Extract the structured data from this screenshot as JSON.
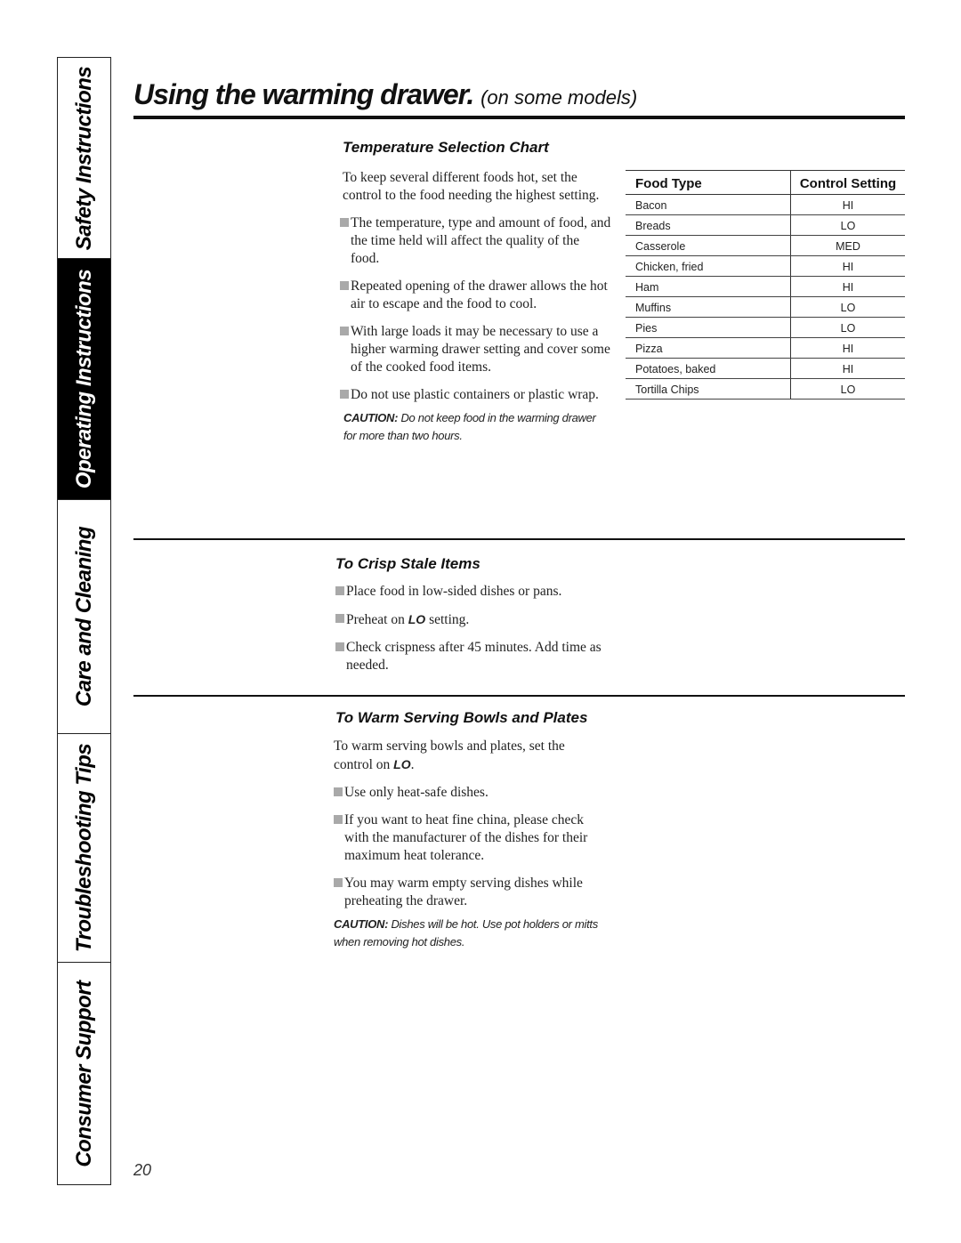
{
  "sidebar": {
    "tabs": [
      {
        "label": "Safety Instructions",
        "active": false
      },
      {
        "label": "Operating Instructions",
        "active": true
      },
      {
        "label": "Care and Cleaning",
        "active": false
      },
      {
        "label": "Troubleshooting Tips",
        "active": false
      },
      {
        "label": "Consumer Support",
        "active": false
      }
    ]
  },
  "header": {
    "title": "Using the warming drawer.",
    "subtitle": "(on some models)"
  },
  "temperature_chart": {
    "heading": "Temperature Selection Chart",
    "intro": "To keep several different foods hot, set the control to the food needing the highest setting.",
    "bullets": [
      "The temperature, type and amount of food, and the time held will affect the quality of the food.",
      "Repeated opening of the drawer allows the hot air to escape and the food to cool.",
      "With large loads it may be necessary to use a higher warming drawer setting and cover some of the cooked food items.",
      "Do not use plastic containers or plastic wrap."
    ],
    "caution_label": "CAUTION:",
    "caution_text": "Do not keep food in the warming drawer for more than two hours.",
    "table": {
      "headers": [
        "Food Type",
        "Control Setting"
      ],
      "rows": [
        [
          "Bacon",
          "HI"
        ],
        [
          "Breads",
          "LO"
        ],
        [
          "Casserole",
          "MED"
        ],
        [
          "Chicken, fried",
          "HI"
        ],
        [
          "Ham",
          "HI"
        ],
        [
          "Muffins",
          "LO"
        ],
        [
          "Pies",
          "LO"
        ],
        [
          "Pizza",
          "HI"
        ],
        [
          "Potatoes, baked",
          "HI"
        ],
        [
          "Tortilla Chips",
          "LO"
        ]
      ]
    }
  },
  "crisp": {
    "heading": "To Crisp Stale Items",
    "bullet1": "Place food in low-sided dishes or pans.",
    "bullet2_pre": "Preheat on ",
    "bullet2_setting": "LO",
    "bullet2_post": " setting.",
    "bullet3": "Check crispness after 45 minutes. Add time as needed."
  },
  "warm_bowls": {
    "heading": "To Warm Serving Bowls and Plates",
    "intro_pre": "To warm serving bowls and plates, set the control on ",
    "intro_setting": "LO",
    "intro_post": ".",
    "bullets": [
      "Use only heat-safe dishes.",
      "If you want to heat fine china, please check with the manufacturer of the dishes for their maximum heat tolerance.",
      "You may warm empty serving dishes while preheating the drawer."
    ],
    "caution_label": "CAUTION:",
    "caution_text": "Dishes will be hot. Use pot holders or mitts when removing hot dishes."
  },
  "footer": {
    "page_number": "20"
  }
}
